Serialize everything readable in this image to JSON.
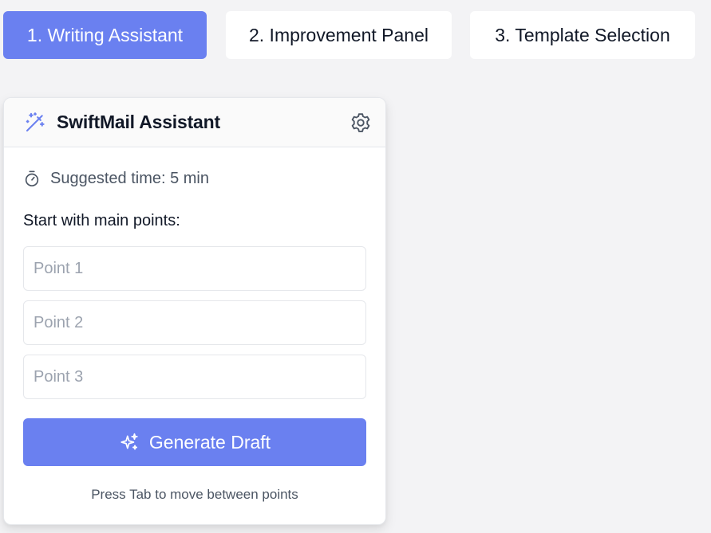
{
  "tabs": [
    {
      "label": "1. Writing Assistant",
      "active": true
    },
    {
      "label": "2. Improvement Panel",
      "active": false
    },
    {
      "label": "3. Template Selection",
      "active": false
    }
  ],
  "card": {
    "title": "SwiftMail Assistant",
    "header_icon": "magic-wand-icon",
    "settings_icon": "gear-icon",
    "timer_icon": "stopwatch-icon",
    "suggested_time": "Suggested time: 5 min",
    "section_label": "Start with main points:",
    "points": [
      {
        "placeholder": "Point 1",
        "value": ""
      },
      {
        "placeholder": "Point 2",
        "value": ""
      },
      {
        "placeholder": "Point 3",
        "value": ""
      }
    ],
    "generate_label": "Generate Draft",
    "generate_icon": "sparkles-icon",
    "hint": "Press Tab to move between points"
  },
  "colors": {
    "accent": "#6a80f0",
    "background": "#f3f3f5",
    "muted_text": "#4b5563",
    "placeholder": "#9ca3af"
  }
}
